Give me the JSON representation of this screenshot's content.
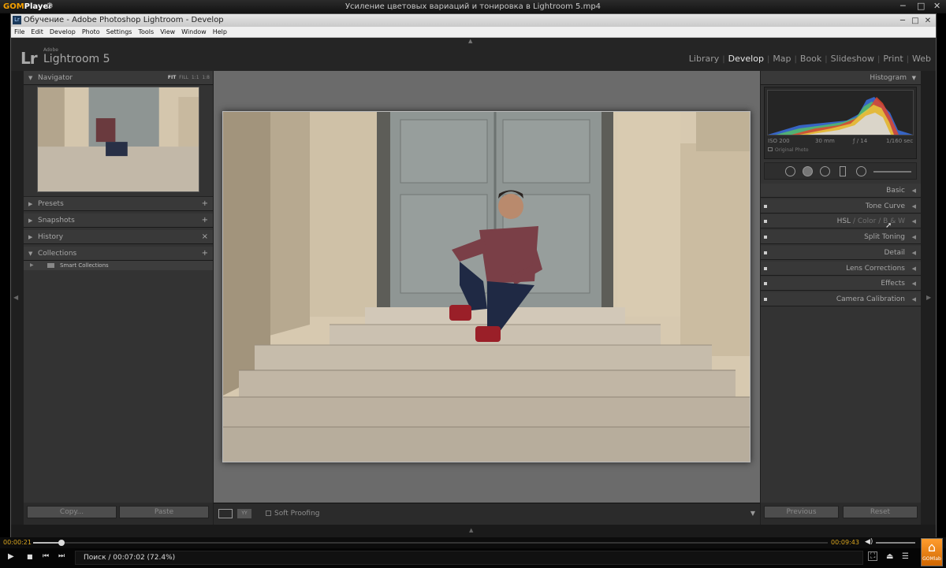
{
  "player": {
    "name_prefix": "GOM",
    "name_suffix": "Player",
    "file_title": "Усиление цветовых вариаций и тонировка в Lightroom 5.mp4",
    "elapsed": "00:00:21",
    "total": "00:09:43",
    "progress_fraction": 0.036,
    "status_text": "Поиск / 00:07:02 (72.4%)",
    "badge_label": "GOMlab"
  },
  "window": {
    "title": "Обучение - Adobe Photoshop Lightroom - Develop",
    "menu": [
      "File",
      "Edit",
      "Develop",
      "Photo",
      "Settings",
      "Tools",
      "View",
      "Window",
      "Help"
    ]
  },
  "lightroom": {
    "logo": "Lr",
    "adobe": "Adobe",
    "product": "Lightroom 5",
    "modules": [
      {
        "label": "Library",
        "active": false
      },
      {
        "label": "Develop",
        "active": true
      },
      {
        "label": "Map",
        "active": false
      },
      {
        "label": "Book",
        "active": false
      },
      {
        "label": "Slideshow",
        "active": false
      },
      {
        "label": "Print",
        "active": false
      },
      {
        "label": "Web",
        "active": false
      }
    ]
  },
  "left_panel": {
    "navigator": {
      "label": "Navigator",
      "opts": [
        "FIT",
        "FILL",
        "1:1",
        "1:8"
      ]
    },
    "presets": {
      "label": "Presets",
      "action": "+"
    },
    "snapshots": {
      "label": "Snapshots",
      "action": "+"
    },
    "history": {
      "label": "History",
      "action": "×"
    },
    "collections": {
      "label": "Collections",
      "action": "+"
    },
    "smart_collections": "Smart Collections",
    "copy_button": "Copy...",
    "paste_button": "Paste"
  },
  "right_panel": {
    "histogram": {
      "label": "Histogram",
      "iso": "ISO 200",
      "focal": "30 mm",
      "aperture": "ƒ / 14",
      "shutter": "1/160 sec",
      "original": "Original Photo"
    },
    "sections": {
      "basic": "Basic",
      "tone_curve": "Tone Curve",
      "hsl": "HSL",
      "color": "Color",
      "bw": "B & W",
      "split_toning": "Split Toning",
      "detail": "Detail",
      "lens": "Lens Corrections",
      "effects": "Effects",
      "camera": "Camera Calibration"
    },
    "previous_button": "Previous",
    "reset_button": "Reset"
  },
  "toolbar": {
    "soft_proofing": "Soft Proofing",
    "view_icon": "YY"
  },
  "colors": {
    "gom_accent": "#f5a000",
    "lr_panel": "#333333",
    "canvas": "#6b6b6b"
  }
}
